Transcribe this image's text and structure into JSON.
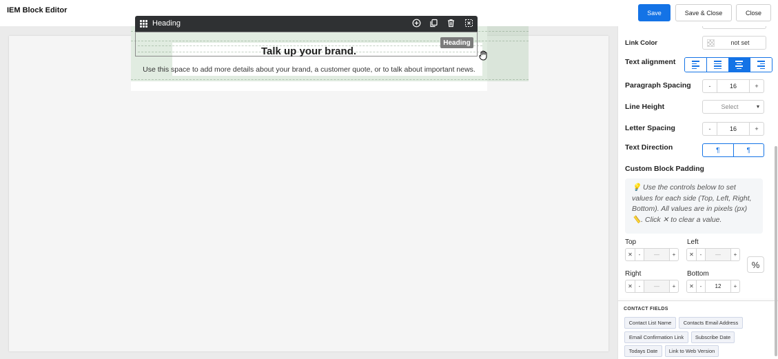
{
  "app": {
    "title": "IEM Block Editor"
  },
  "actions": {
    "save": "Save",
    "save_close": "Save & Close",
    "close": "Close"
  },
  "colors": {
    "accent": "#1473e6",
    "toolbar_bg": "#2f3133",
    "canvas_bg": "#f5f5f5"
  },
  "block": {
    "toolbar_title": "Heading",
    "toolbar_icons": [
      "plus-circle-icon",
      "duplicate-icon",
      "trash-icon",
      "deselect-icon"
    ],
    "heading_text": "Talk up your brand.",
    "badge": "Heading",
    "body_text": "Use this space to add more details about your brand, a customer quote, or to talk about important news."
  },
  "panel": {
    "link_color": {
      "label": "Link Color",
      "value": "not set"
    },
    "text_alignment": {
      "label": "Text alignment",
      "options": [
        "left",
        "justify",
        "center",
        "right"
      ],
      "selected": "center"
    },
    "paragraph_spacing": {
      "label": "Paragraph Spacing",
      "minus": "-",
      "value": "16",
      "plus": "+"
    },
    "line_height": {
      "label": "Line Height",
      "placeholder": "Select"
    },
    "letter_spacing": {
      "label": "Letter Spacing",
      "minus": "-",
      "value": "16",
      "plus": "+"
    },
    "text_direction": {
      "label": "Text Direction",
      "options": [
        "ltr",
        "rtl"
      ]
    },
    "custom_padding": {
      "label": "Custom Block Padding",
      "info": "💡 Use the controls below to set values for each side (Top, Left, Right, Bottom). All values are in pixels (px) 📏. Click ✕ to clear a value.",
      "clear": "✕",
      "minus": "-",
      "plus": "+",
      "dash": "—",
      "top": {
        "label": "Top",
        "value": ""
      },
      "left": {
        "label": "Left",
        "value": ""
      },
      "right": {
        "label": "Right",
        "value": ""
      },
      "bottom": {
        "label": "Bottom",
        "value": "12"
      }
    },
    "contact_fields": {
      "title": "CONTACT FIELDS",
      "items": [
        "Contact List Name",
        "Contacts Email Address",
        "Email Confirmation Link",
        "Subscribe Date",
        "Todays Date",
        "Link to Web Version"
      ]
    }
  }
}
